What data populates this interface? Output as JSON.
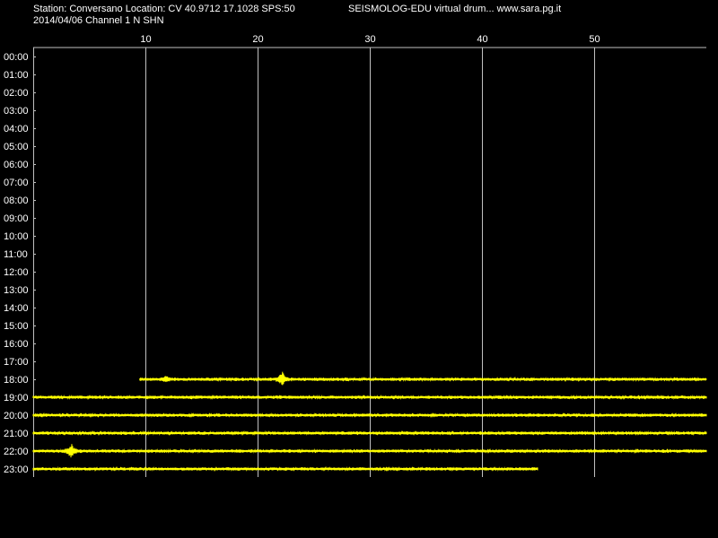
{
  "header": {
    "station_line": "Station: Conversano Location: CV 40.9712 17.1028 SPS:50",
    "program_line": "SEISMOLOG-EDU virtual drum... www.sara.pg.it",
    "date_line": "2014/04/06  Channel 1 N SHN"
  },
  "colors": {
    "background": "#000000",
    "trace": "#ffff00",
    "grid": "#c0c0c0",
    "text": "#ffffff"
  },
  "chart_data": {
    "type": "line",
    "title": "",
    "xlabel": "",
    "ylabel": "",
    "x_ticks": [
      "10",
      "20",
      "30",
      "40",
      "50"
    ],
    "x_tick_values": [
      10,
      20,
      30,
      40,
      50
    ],
    "xlim": [
      0,
      60
    ],
    "rows": [
      "00:00",
      "01:00",
      "02:00",
      "03:00",
      "04:00",
      "05:00",
      "06:00",
      "07:00",
      "08:00",
      "09:00",
      "10:00",
      "11:00",
      "12:00",
      "13:00",
      "14:00",
      "15:00",
      "16:00",
      "17:00",
      "18:00",
      "19:00",
      "20:00",
      "21:00",
      "22:00",
      "23:00"
    ],
    "grid": true,
    "traces": [
      {
        "hour": "18:00",
        "start_min": 9.5,
        "end_min": 60,
        "events": [
          {
            "min": 22.2,
            "amp": 1.0
          },
          {
            "min": 11.8,
            "amp": 0.35
          }
        ]
      },
      {
        "hour": "19:00",
        "start_min": 0,
        "end_min": 60,
        "events": []
      },
      {
        "hour": "20:00",
        "start_min": 0,
        "end_min": 60,
        "events": []
      },
      {
        "hour": "21:00",
        "start_min": 0,
        "end_min": 60,
        "events": []
      },
      {
        "hour": "22:00",
        "start_min": 0,
        "end_min": 60,
        "events": [
          {
            "min": 3.4,
            "amp": 1.0
          }
        ]
      },
      {
        "hour": "23:00",
        "start_min": 0,
        "end_min": 45,
        "events": []
      }
    ]
  }
}
